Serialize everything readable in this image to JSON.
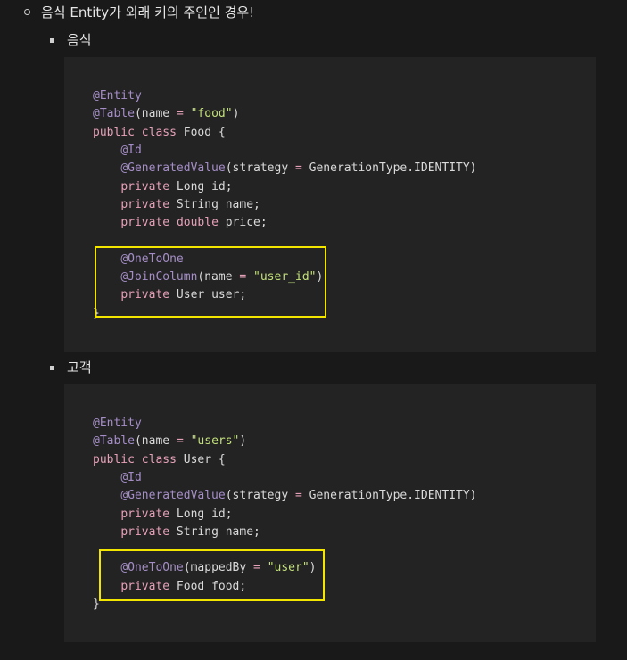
{
  "heading": "음식 Entity가 외래 키의 주인인 경우!",
  "sections": [
    {
      "label": "음식",
      "code": [
        {
          "tokens": [
            [
              "ann",
              "@Entity"
            ]
          ]
        },
        {
          "tokens": [
            [
              "ann",
              "@Table"
            ],
            [
              "plain",
              "(name "
            ],
            [
              "op",
              "="
            ],
            [
              "plain",
              " "
            ],
            [
              "str",
              "\"food\""
            ],
            [
              "plain",
              ")"
            ]
          ]
        },
        {
          "tokens": [
            [
              "kw",
              "public"
            ],
            [
              "plain",
              " "
            ],
            [
              "kw",
              "class"
            ],
            [
              "plain",
              " Food {"
            ]
          ]
        },
        {
          "tokens": [
            [
              "plain",
              "    "
            ],
            [
              "ann",
              "@Id"
            ]
          ]
        },
        {
          "tokens": [
            [
              "plain",
              "    "
            ],
            [
              "ann",
              "@GeneratedValue"
            ],
            [
              "plain",
              "(strategy "
            ],
            [
              "op",
              "="
            ],
            [
              "plain",
              " GenerationType.IDENTITY)"
            ]
          ]
        },
        {
          "tokens": [
            [
              "plain",
              "    "
            ],
            [
              "kw",
              "private"
            ],
            [
              "plain",
              " Long id;"
            ]
          ]
        },
        {
          "tokens": [
            [
              "plain",
              "    "
            ],
            [
              "kw",
              "private"
            ],
            [
              "plain",
              " String name;"
            ]
          ]
        },
        {
          "tokens": [
            [
              "plain",
              "    "
            ],
            [
              "kw",
              "private"
            ],
            [
              "plain",
              " "
            ],
            [
              "kw",
              "double"
            ],
            [
              "plain",
              " price;"
            ]
          ]
        },
        {
          "tokens": [
            [
              "plain",
              ""
            ]
          ]
        },
        {
          "tokens": [
            [
              "plain",
              "    "
            ],
            [
              "ann",
              "@OneToOne"
            ]
          ]
        },
        {
          "tokens": [
            [
              "plain",
              "    "
            ],
            [
              "ann",
              "@JoinColumn"
            ],
            [
              "plain",
              "(name "
            ],
            [
              "op",
              "="
            ],
            [
              "plain",
              " "
            ],
            [
              "str",
              "\"user_id\""
            ],
            [
              "plain",
              ")"
            ]
          ]
        },
        {
          "tokens": [
            [
              "plain",
              "    "
            ],
            [
              "kw",
              "private"
            ],
            [
              "plain",
              " User user;"
            ]
          ]
        },
        {
          "tokens": [
            [
              "plain",
              "}"
            ]
          ]
        }
      ]
    },
    {
      "label": "고객",
      "code": [
        {
          "tokens": [
            [
              "ann",
              "@Entity"
            ]
          ]
        },
        {
          "tokens": [
            [
              "ann",
              "@Table"
            ],
            [
              "plain",
              "(name "
            ],
            [
              "op",
              "="
            ],
            [
              "plain",
              " "
            ],
            [
              "str",
              "\"users\""
            ],
            [
              "plain",
              ")"
            ]
          ]
        },
        {
          "tokens": [
            [
              "kw",
              "public"
            ],
            [
              "plain",
              " "
            ],
            [
              "kw",
              "class"
            ],
            [
              "plain",
              " User {"
            ]
          ]
        },
        {
          "tokens": [
            [
              "plain",
              "    "
            ],
            [
              "ann",
              "@Id"
            ]
          ]
        },
        {
          "tokens": [
            [
              "plain",
              "    "
            ],
            [
              "ann",
              "@GeneratedValue"
            ],
            [
              "plain",
              "(strategy "
            ],
            [
              "op",
              "="
            ],
            [
              "plain",
              " GenerationType.IDENTITY)"
            ]
          ]
        },
        {
          "tokens": [
            [
              "plain",
              "    "
            ],
            [
              "kw",
              "private"
            ],
            [
              "plain",
              " Long id;"
            ]
          ]
        },
        {
          "tokens": [
            [
              "plain",
              "    "
            ],
            [
              "kw",
              "private"
            ],
            [
              "plain",
              " String name;"
            ]
          ]
        },
        {
          "tokens": [
            [
              "plain",
              ""
            ]
          ]
        },
        {
          "tokens": [
            [
              "plain",
              "    "
            ],
            [
              "ann",
              "@OneToOne"
            ],
            [
              "plain",
              "(mappedBy "
            ],
            [
              "op",
              "="
            ],
            [
              "plain",
              " "
            ],
            [
              "str",
              "\"user\""
            ],
            [
              "plain",
              ")"
            ]
          ]
        },
        {
          "tokens": [
            [
              "plain",
              "    "
            ],
            [
              "kw",
              "private"
            ],
            [
              "plain",
              " Food food;"
            ]
          ]
        },
        {
          "tokens": [
            [
              "plain",
              "}"
            ]
          ]
        }
      ]
    }
  ]
}
